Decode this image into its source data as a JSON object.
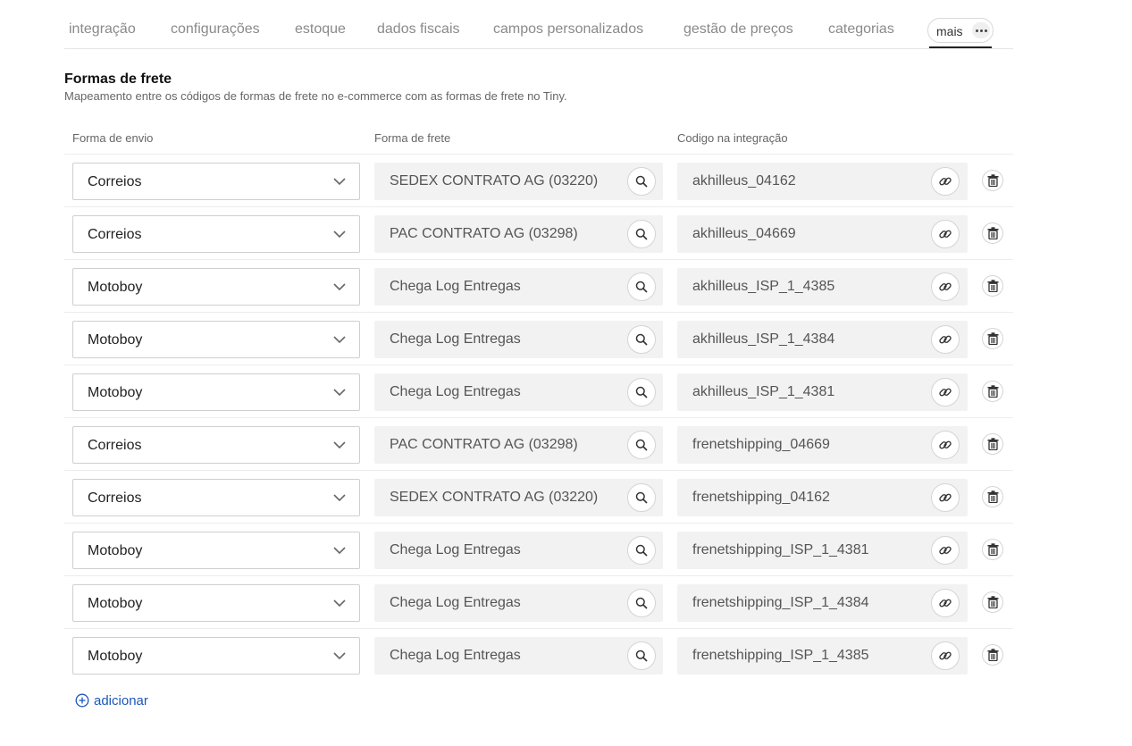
{
  "tabs": [
    {
      "label": "integração"
    },
    {
      "label": "configurações"
    },
    {
      "label": "estoque"
    },
    {
      "label": "dados fiscais"
    },
    {
      "label": "campos personalizados"
    },
    {
      "label": "gestão de preços"
    },
    {
      "label": "categorias"
    }
  ],
  "more_tab": {
    "label": "mais",
    "icon": "more-dots-icon",
    "active": true
  },
  "section": {
    "title": "Formas de frete",
    "description": "Mapeamento entre os códigos de formas de frete no e-commerce com as formas de frete no Tiny."
  },
  "columns": {
    "forma_envio": "Forma de envio",
    "forma_frete": "Forma de frete",
    "codigo": "Codigo na integração"
  },
  "rows": [
    {
      "envio": "Correios",
      "frete": "SEDEX CONTRATO AG (03220)",
      "codigo": "akhilleus_04162"
    },
    {
      "envio": "Correios",
      "frete": "PAC CONTRATO AG (03298)",
      "codigo": "akhilleus_04669"
    },
    {
      "envio": "Motoboy",
      "frete": "Chega Log Entregas",
      "codigo": "akhilleus_ISP_1_4385"
    },
    {
      "envio": "Motoboy",
      "frete": "Chega Log Entregas",
      "codigo": "akhilleus_ISP_1_4384"
    },
    {
      "envio": "Motoboy",
      "frete": "Chega Log Entregas",
      "codigo": "akhilleus_ISP_1_4381"
    },
    {
      "envio": "Correios",
      "frete": "PAC CONTRATO AG (03298)",
      "codigo": "frenetshipping_04669"
    },
    {
      "envio": "Correios",
      "frete": "SEDEX CONTRATO AG (03220)",
      "codigo": "frenetshipping_04162"
    },
    {
      "envio": "Motoboy",
      "frete": "Chega Log Entregas",
      "codigo": "frenetshipping_ISP_1_4381"
    },
    {
      "envio": "Motoboy",
      "frete": "Chega Log Entregas",
      "codigo": "frenetshipping_ISP_1_4384"
    },
    {
      "envio": "Motoboy",
      "frete": "Chega Log Entregas",
      "codigo": "frenetshipping_ISP_1_4385"
    }
  ],
  "add": {
    "label": "adicionar",
    "icon": "plus-circle-icon"
  },
  "colors": {
    "link": "#1d57b8",
    "field_bg": "#f2f2f2",
    "tab_inactive": "#8a8a8a"
  }
}
